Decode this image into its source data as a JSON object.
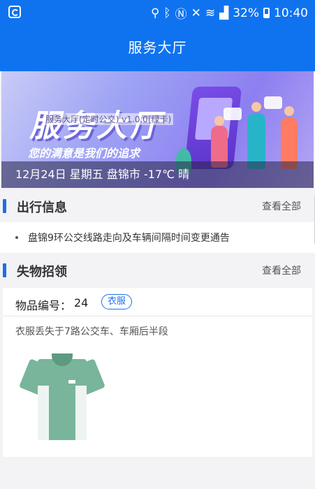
{
  "statusbar": {
    "battery": "32%",
    "time": "10:40"
  },
  "header": {
    "title": "服务大厅"
  },
  "banner": {
    "art_title": "服务大厅",
    "slogan": "您的满意是我们的追求",
    "overlay": "服务大厅(定时公交) v1.0.0(绿卡)",
    "date_weather": "12月24日 星期五 盘锦市 -17℃ 晴"
  },
  "travel": {
    "title": "出行信息",
    "more": "查看全部",
    "items": [
      "盘锦9环公交线路走向及车辆间隔时间变更通告"
    ]
  },
  "lost_found": {
    "title": "失物招领",
    "more": "查看全部",
    "item": {
      "number_label": "物品编号：",
      "number": "24",
      "tag": "衣服",
      "description": "衣服丢失于7路公交车、车厢后半段"
    }
  },
  "colors": {
    "primary": "#0f73f0",
    "accent": "#1e70e8",
    "background": "#f3f3f5"
  }
}
